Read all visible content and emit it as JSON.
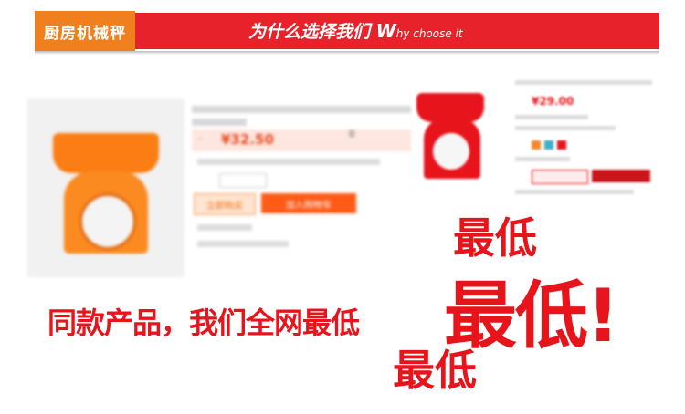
{
  "header": {
    "tag": "厨房机械秤",
    "title_cn": "为什么选择我们",
    "title_en_first": "W",
    "title_en_rest": "hy choose it",
    "colors": {
      "tag": "#f07f1e",
      "bar": "#e8222a"
    }
  },
  "product1": {
    "price": "¥32.50",
    "count": "0",
    "buy_label": "立即购买",
    "cart_label": "加入购物车"
  },
  "product2": {
    "price": "¥29.00"
  },
  "slogan": {
    "text": "同款产品，我们全网最低",
    "low_top": "最低",
    "low_big": "最低!",
    "low_bottom": "最低",
    "color": "#e8141c"
  }
}
